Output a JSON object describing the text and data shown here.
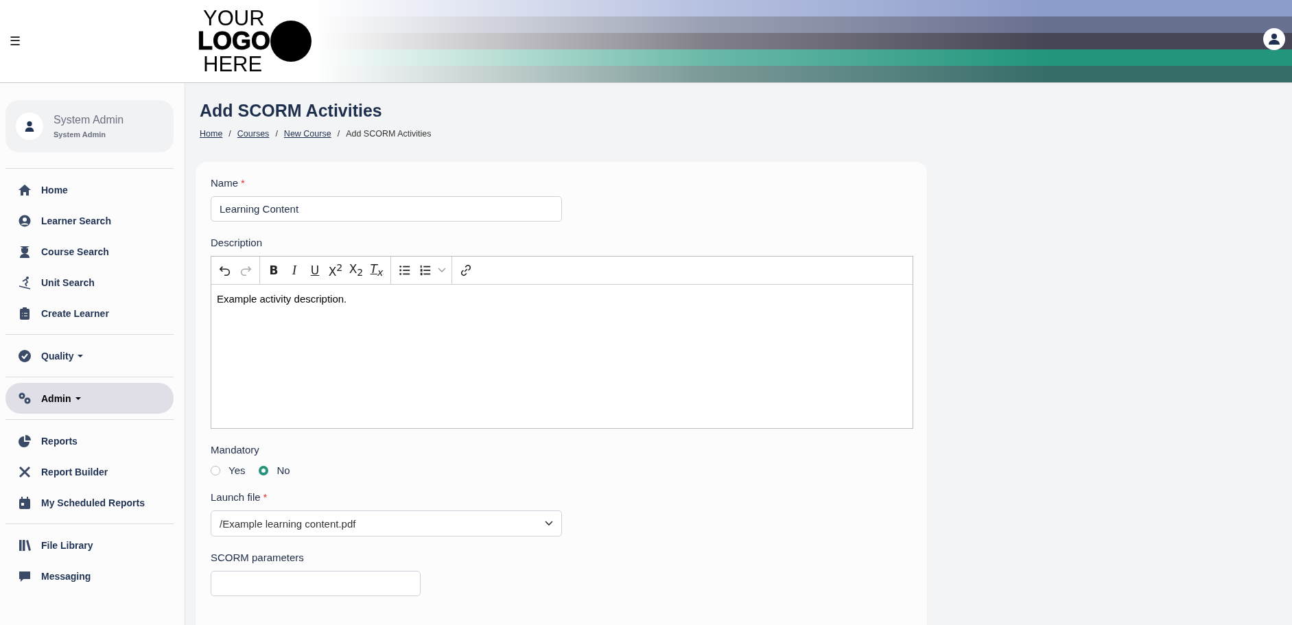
{
  "header": {
    "menu_glyph": "☰",
    "logo": {
      "line_1": "YOUR",
      "line_2": "LOGO",
      "line_3": "HERE"
    }
  },
  "sidebar": {
    "user": {
      "name": "System Admin",
      "role": "System Admin"
    },
    "groups": [
      [
        {
          "label": "Home",
          "kind": "link",
          "selected": false
        },
        {
          "label": "Learner Search",
          "kind": "link",
          "selected": false
        },
        {
          "label": "Course Search",
          "kind": "link",
          "selected": false
        },
        {
          "label": "Unit Search",
          "kind": "link",
          "selected": false
        },
        {
          "label": "Create Learner",
          "kind": "link",
          "selected": false
        }
      ],
      [
        {
          "label": "Quality",
          "kind": "menu",
          "selected": false
        }
      ],
      [
        {
          "label": "Admin",
          "kind": "menu",
          "selected": true
        }
      ],
      [
        {
          "label": "Reports",
          "kind": "link",
          "selected": false
        },
        {
          "label": "Report Builder",
          "kind": "link",
          "selected": false
        },
        {
          "label": "My Scheduled Reports",
          "kind": "link",
          "selected": false
        }
      ],
      [
        {
          "label": "File Library",
          "kind": "link",
          "selected": false
        },
        {
          "label": "Messaging",
          "kind": "link",
          "selected": false
        }
      ]
    ]
  },
  "page": {
    "title": "Add SCORM Activities",
    "breadcrumb": [
      {
        "kind": "link",
        "label": "Home"
      },
      {
        "kind": "separator",
        "label": "/"
      },
      {
        "kind": "link",
        "label": "Courses"
      },
      {
        "kind": "separator",
        "label": "/"
      },
      {
        "kind": "link",
        "label": "New Course"
      },
      {
        "kind": "separator",
        "label": "/"
      },
      {
        "kind": "current",
        "label": "Add SCORM Activities"
      }
    ]
  },
  "form": {
    "fields": [
      {
        "kind": "text",
        "label": "Name",
        "required_mark": "*",
        "value": "Learning Content"
      },
      {
        "kind": "editor",
        "label": "Description",
        "value": "Example activity description.",
        "toolbar": [
          [
            {
              "kind": "undo",
              "disabled": false
            },
            {
              "kind": "redo",
              "disabled": true
            }
          ],
          [
            {
              "kind": "bold",
              "label": "B",
              "disabled": false
            },
            {
              "kind": "italic",
              "label": "I",
              "disabled": false
            },
            {
              "kind": "underline",
              "label": "U",
              "disabled": false
            },
            {
              "kind": "plain",
              "label": "X$^{2}$",
              "disabled": false
            },
            {
              "kind": "plain",
              "label": "X$_{2}$",
              "disabled": false
            },
            {
              "kind": "clear",
              "label": "T$_{x}$",
              "disabled": false
            }
          ],
          [
            {
              "kind": "bullets",
              "disabled": false
            },
            {
              "kind": "numbers",
              "disabled": false
            },
            {
              "kind": "dropdown",
              "disabled": false
            }
          ],
          [
            {
              "kind": "link",
              "disabled": false
            }
          ]
        ]
      },
      {
        "kind": "radio",
        "label": "Mandatory",
        "options": [
          {
            "label": "Yes",
            "selected": false
          },
          {
            "label": "No",
            "selected": true
          }
        ]
      },
      {
        "kind": "select",
        "label": "Launch file",
        "required_mark": "*",
        "value": "/Example learning content.pdf"
      },
      {
        "kind": "short",
        "label": "SCORM parameters"
      }
    ]
  }
}
